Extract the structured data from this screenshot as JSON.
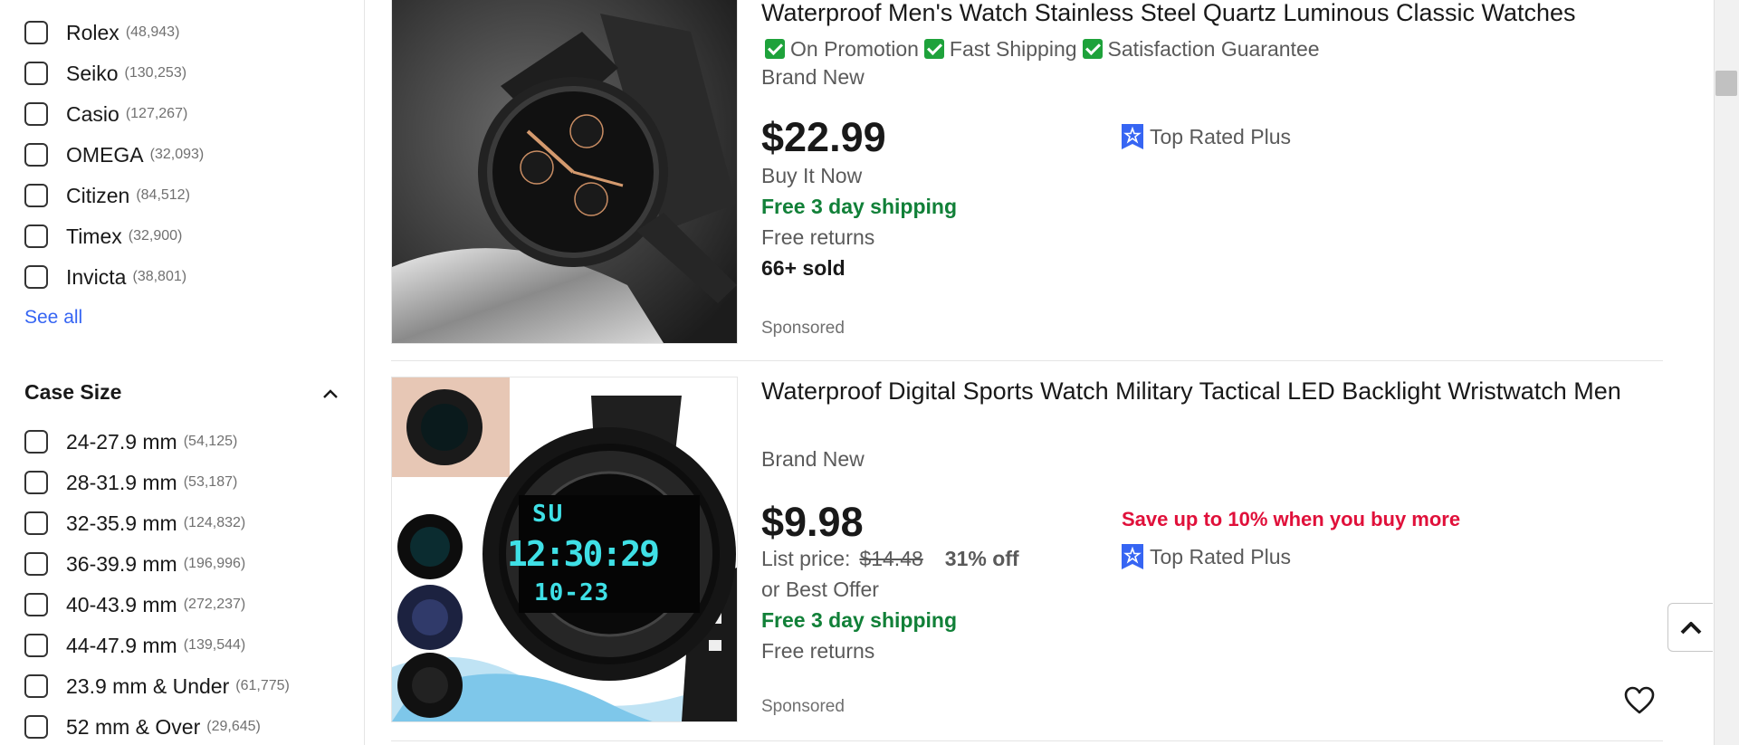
{
  "brand_facet": {
    "items": [
      {
        "label": "Rolex",
        "count": "(48,943)"
      },
      {
        "label": "Seiko",
        "count": "(130,253)"
      },
      {
        "label": "Casio",
        "count": "(127,267)"
      },
      {
        "label": "OMEGA",
        "count": "(32,093)"
      },
      {
        "label": "Citizen",
        "count": "(84,512)"
      },
      {
        "label": "Timex",
        "count": "(32,900)"
      },
      {
        "label": "Invicta",
        "count": "(38,801)"
      }
    ],
    "see_all": "See all"
  },
  "case_size_facet": {
    "title": "Case Size",
    "items": [
      {
        "label": "24-27.9 mm",
        "count": "(54,125)"
      },
      {
        "label": "28-31.9 mm",
        "count": "(53,187)"
      },
      {
        "label": "32-35.9 mm",
        "count": "(124,832)"
      },
      {
        "label": "36-39.9 mm",
        "count": "(196,996)"
      },
      {
        "label": "40-43.9 mm",
        "count": "(272,237)"
      },
      {
        "label": "44-47.9 mm",
        "count": "(139,544)"
      },
      {
        "label": "23.9 mm & Under",
        "count": "(61,775)"
      },
      {
        "label": "52 mm & Over",
        "count": "(29,645)"
      }
    ]
  },
  "listings": [
    {
      "title": "Waterproof Men's Watch Stainless Steel Quartz Luminous Classic Watches",
      "badges": [
        "On Promotion",
        "Fast Shipping",
        "Satisfaction Guarantee"
      ],
      "condition": "Brand New",
      "price": "$22.99",
      "buy_format": "Buy It Now",
      "shipping": "Free 3 day shipping",
      "returns": "Free returns",
      "sold": "66+ sold",
      "top_rated": "Top Rated Plus",
      "sponsored": "Sponsored"
    },
    {
      "title": "Waterproof Digital Sports Watch Military Tactical LED Backlight Wristwatch Men",
      "condition": "Brand New",
      "price": "$9.98",
      "list_price_label": "List price:",
      "list_price": "$14.48",
      "discount": "31% off",
      "offer": "or Best Offer",
      "shipping": "Free 3 day shipping",
      "returns": "Free returns",
      "save_more": "Save up to 10% when you buy more",
      "top_rated": "Top Rated Plus",
      "sponsored": "Sponsored",
      "watch_display": {
        "top": "SU",
        "time": "12:30:29",
        "date": "10-23"
      }
    }
  ],
  "colors": {
    "link": "#3665f3",
    "shipping_green": "#118038",
    "save_red": "#e0103a",
    "badge_green": "#1ea23b",
    "top_rated_blue": "#3665f3",
    "lcd_cyan": "#3fe0e6"
  }
}
